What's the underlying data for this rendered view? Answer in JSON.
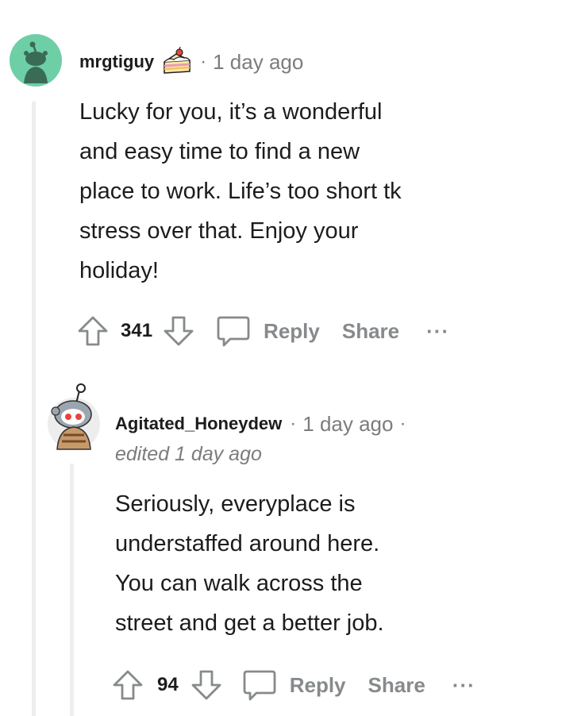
{
  "comments": [
    {
      "username": "mrgtiguy",
      "separator": "·",
      "time": "1 day ago",
      "body_lines": [
        "Lucky for you, it’s a wonderful",
        "and easy time to find a new",
        "place to work. Life’s too short tk",
        "stress over that. Enjoy your",
        "holiday!"
      ],
      "score": "341",
      "reply_label": "Reply",
      "share_label": "Share",
      "more_label": "···",
      "avatar_color": "#6ecfa6",
      "award_icon": "cake-icon"
    },
    {
      "username": "Agitated_Honeydew",
      "separator": "·",
      "time": "1 day ago",
      "separator_after": "·",
      "edited": "edited 1 day ago",
      "body_lines": [
        "Seriously, everyplace is",
        "understaffed around here.",
        "You can walk across the",
        "street and get a better job."
      ],
      "score": "94",
      "reply_label": "Reply",
      "share_label": "Share",
      "more_label": "···"
    }
  ],
  "colors": {
    "thread_line": "#eceeef",
    "meta_gray": "#7c7c7c",
    "action_gray": "#878a8c"
  }
}
